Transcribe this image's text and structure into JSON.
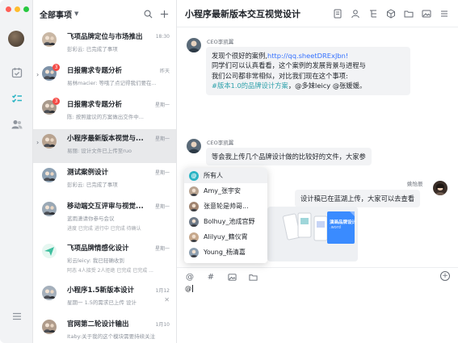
{
  "colors": {
    "accent": "#3370ff",
    "teal": "#2bb4c4",
    "badge": "#f54a45",
    "rail_active": "#2bb4c4"
  },
  "list": {
    "title": "全部事项",
    "conversations": [
      {
        "name": "飞项品牌定位与市场推出",
        "time": "18:30",
        "preview": "彭彩云: 已完成了事项",
        "meta": "",
        "badge": "",
        "avatar": "people"
      },
      {
        "name": "日报需求专题分析",
        "time": "昨天",
        "preview": "易林macier: 等哦了点记得我们要在...",
        "meta": "",
        "badge": "3",
        "avatar": "people",
        "chevron": true
      },
      {
        "name": "日报需求专题分析",
        "time": "星期一",
        "preview": "陈: 按照建议的方案做出交件中...",
        "meta": "",
        "badge": "3",
        "avatar": "people"
      },
      {
        "name": "小程序最新版本视觉与...",
        "time": "星期一",
        "preview": "易丽: 设计文件已上传至ruo",
        "meta": "",
        "badge": "",
        "avatar": "people",
        "chevron": true,
        "active": true
      },
      {
        "name": "测试案例设计",
        "time": "星期一",
        "preview": "彭彩云: 已完成了事项",
        "meta": "",
        "badge": "",
        "avatar": "people"
      },
      {
        "name": "移动端交互评审与视觉...",
        "time": "星期一",
        "preview": "蓝雨潇请你参与会议",
        "meta": "进度  已完成  进行中  已完成  待确认",
        "badge": "",
        "avatar": "people",
        "tall": true
      },
      {
        "name": "飞项品牌情感化设计",
        "time": "星期一",
        "preview": "彩云leicy: 我已轻确收到",
        "meta": "阿态  4人接受 2人拒绝  已完成 已完成 ...",
        "badge": "",
        "avatar": "plane",
        "tall": true
      },
      {
        "name": "小程序1.5新版本设计",
        "time": "1月12",
        "preview": "星期一 1.5的需求已上传 设计",
        "meta": "",
        "badge": "",
        "avatar": "people",
        "mute": true
      },
      {
        "name": "官网第二轮设计输出",
        "time": "1月10",
        "preview": "Itaby:关于我的这个模块需要持续关注",
        "meta": "",
        "badge": "",
        "avatar": "people"
      }
    ]
  },
  "chat": {
    "title": "小程序最新版本交互视觉设计",
    "msg1": {
      "sender": "CEO李凯翼",
      "line1_prefix": "发现个很好的案例,",
      "line1_link": "http://qq.sheetDRExJbn!",
      "line2": "同学们可以认真看看，这个案例的发展背景与进程与",
      "line3": "我们公司都非常相似，对比我们现在这个事项:",
      "line4_topic": "#版本1.0的品牌设计方案",
      "line4_rest": "，@多妹leicy @张媛媛。"
    },
    "msg2": {
      "sender": "CEO李凯翼",
      "text": "等会我上传几个品牌设计做的比较好的文件，大家参"
    },
    "msg3": {
      "sender": "姚怡辰",
      "text": "设计稿已在蓝湖上传，大家可以去查看"
    },
    "doc_label": "演画品牌设计",
    "doc_sub": ".word"
  },
  "mention_popup": {
    "items": [
      {
        "label": "所有人",
        "type": "all"
      },
      {
        "label": "Amy_张宇安",
        "type": "person"
      },
      {
        "label": "张意轮是帅哥...",
        "type": "person"
      },
      {
        "label": "Bolhuy_池成宫野",
        "type": "person"
      },
      {
        "label": "Alilyuy_籍仪霄",
        "type": "person"
      },
      {
        "label": "Young_杨清嘉",
        "type": "person"
      }
    ]
  },
  "input": {
    "text": "@"
  }
}
